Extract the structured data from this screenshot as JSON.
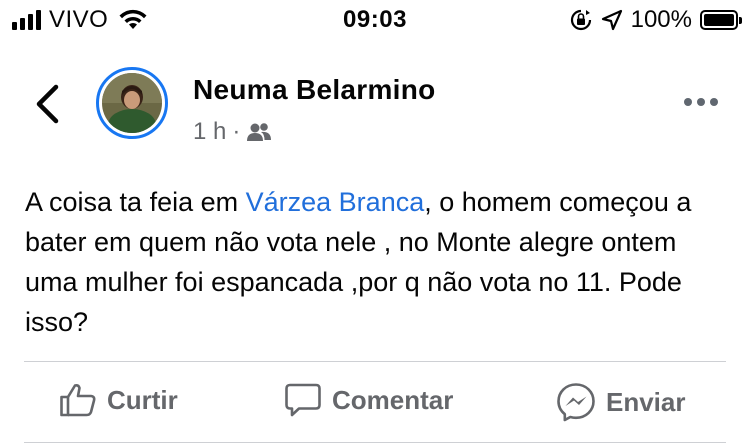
{
  "status_bar": {
    "carrier": "VIVO",
    "time": "09:03",
    "battery": "100%",
    "battery_level": 1.0
  },
  "post": {
    "author": "Neuma Belarmino",
    "time": "1 h",
    "separator": "·",
    "audience_icon": "friends-icon",
    "text_before": "A coisa ta feia em ",
    "text_link": "Várzea Branca",
    "text_after": ", o homem começou a bater em quem não  vota nele , no Monte alegre ontem uma mulher foi espancada ,por q não vota no 11.  Pode isso?"
  },
  "actions": {
    "like": "Curtir",
    "comment": "Comentar",
    "send": "Enviar"
  },
  "colors": {
    "accent": "#1877f2",
    "link": "#216fdb",
    "secondary_text": "#65676b"
  }
}
